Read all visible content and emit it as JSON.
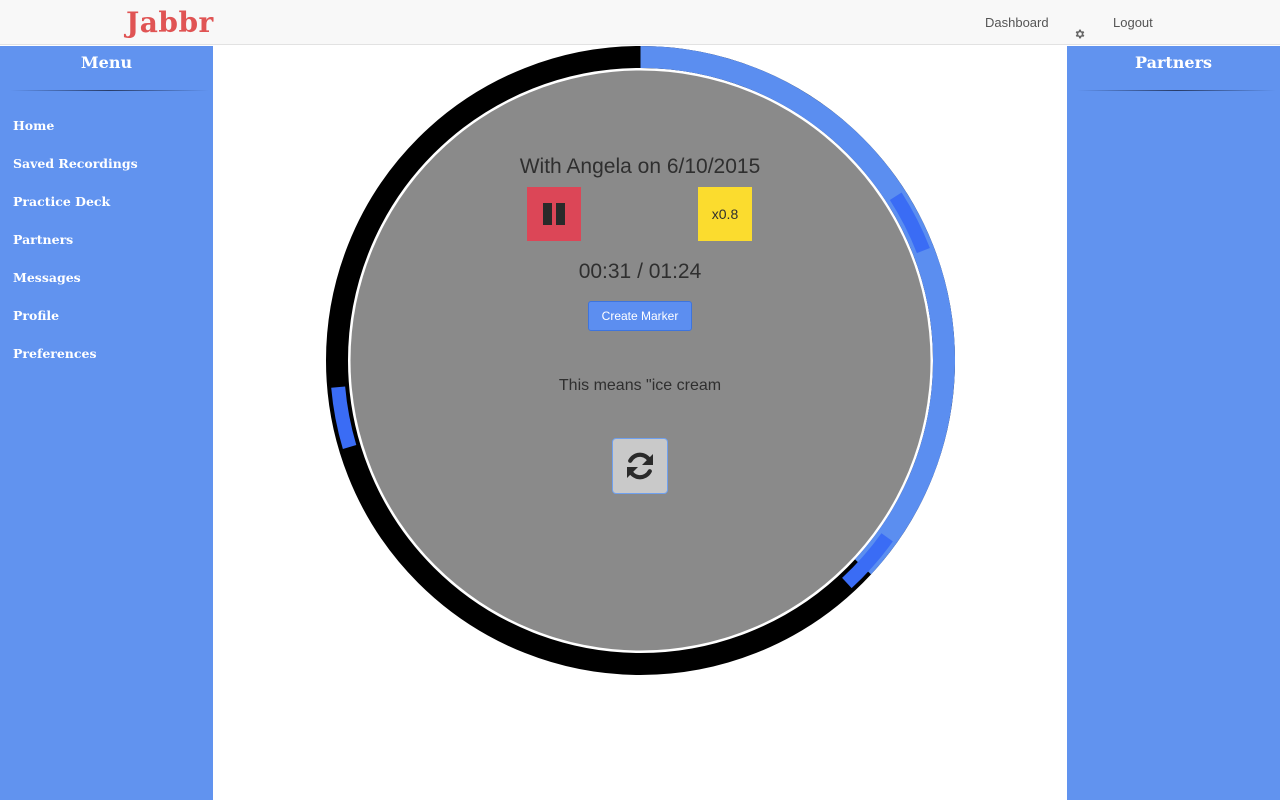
{
  "app": {
    "brand": "Jabbr"
  },
  "navbar": {
    "links": [
      {
        "label": "Dashboard"
      },
      {
        "label": "Logout"
      }
    ],
    "icons": {
      "settings": "gear-icon"
    }
  },
  "sidebar_left": {
    "title": "Menu",
    "items": [
      {
        "label": "Home"
      },
      {
        "label": "Saved Recordings"
      },
      {
        "label": "Practice Deck"
      },
      {
        "label": "Partners"
      },
      {
        "label": "Messages"
      },
      {
        "label": "Profile"
      },
      {
        "label": "Preferences"
      }
    ]
  },
  "sidebar_right": {
    "title": "Partners"
  },
  "player": {
    "title": "With Angela on 6/10/2015",
    "time": "00:31 / 01:24",
    "elapsed_seconds": 31,
    "total_seconds": 84,
    "progress": 0.369,
    "markers": [
      0.175,
      0.365,
      0.72
    ],
    "speed_label": "x0.8",
    "create_marker_label": "Create Marker",
    "marker_note": "This means \"ice cream",
    "icons": {
      "pause": "pause-icon",
      "refresh": "refresh-icon"
    }
  },
  "colors": {
    "brand": "#e05454",
    "sidebar": "#6193ef",
    "ring_track": "#000000",
    "ring_progress": "#5b8ef0",
    "ring_marker": "#3a6cf5",
    "disc": "#8a8a8a",
    "pause_button": "#dc4657",
    "speed_button": "#fbdc2e",
    "primary_button": "#5c8ef0"
  }
}
